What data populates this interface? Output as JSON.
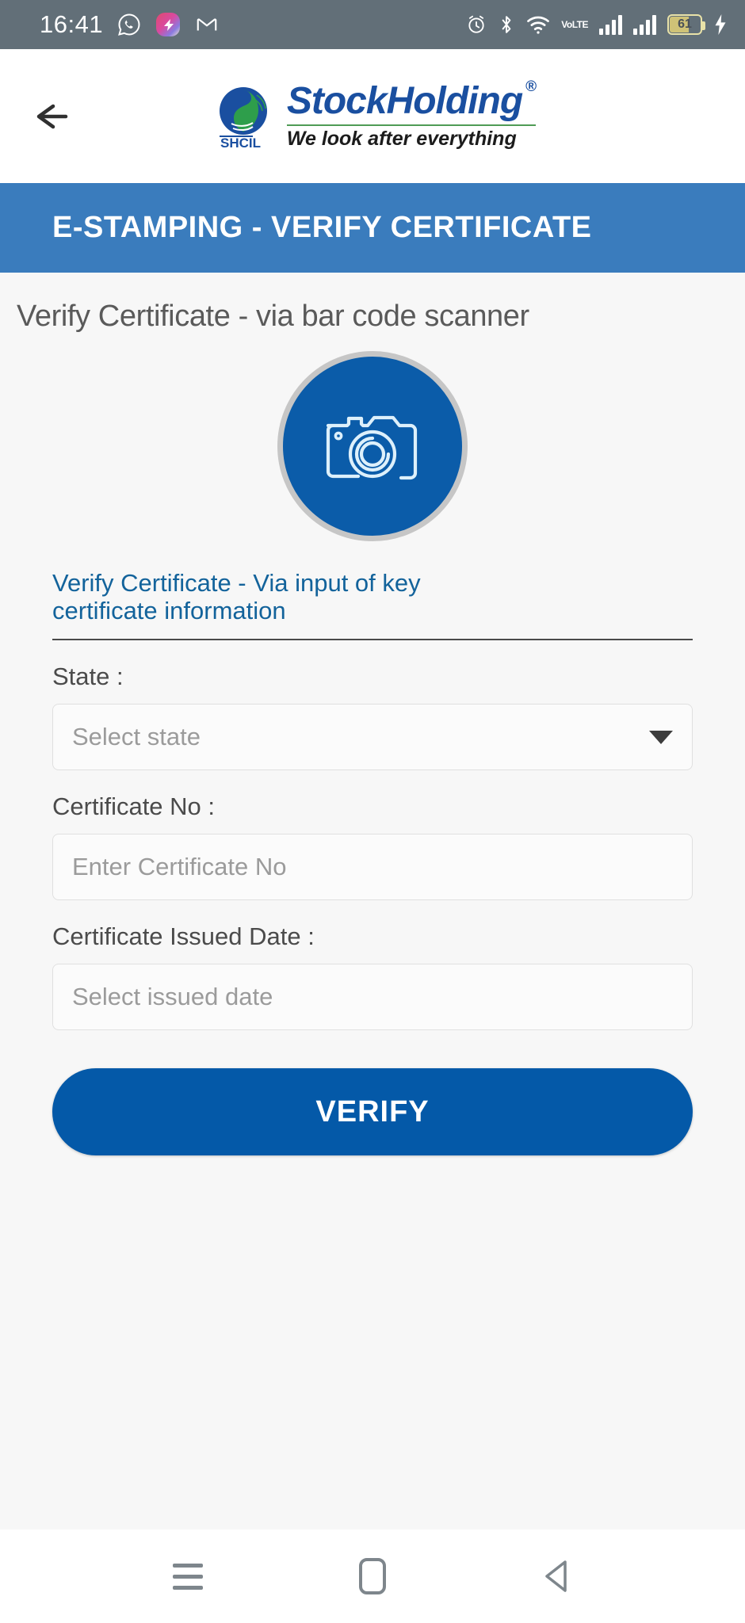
{
  "status_bar": {
    "time": "16:41",
    "left_icons": [
      "whatsapp-icon",
      "app-icon",
      "gmail-icon"
    ],
    "right_icons": [
      "alarm-icon",
      "bluetooth-icon",
      "wifi-icon",
      "volte-icon",
      "signal-sim1-icon",
      "signal-sim2-icon",
      "battery-icon"
    ],
    "volte_top": "Vo",
    "volte_bottom": "LTE",
    "battery_percent": "61",
    "charging": true
  },
  "header": {
    "back_icon": "back-arrow-icon",
    "logo_name": "StockHolding",
    "logo_registered": "®",
    "logo_tagline": "We look after everything",
    "logo_abbr": "SHCIL"
  },
  "banner": {
    "title": "E-STAMPING - VERIFY CERTIFICATE",
    "color": "#3a7cbd"
  },
  "main": {
    "scanner_heading": "Verify Certificate - via bar code scanner",
    "scanner_button_icon": "camera-icon",
    "scanner_button_color": "#0b5ca9",
    "key_info_link": "Verify Certificate - Via input of key certificate information",
    "key_info_link_color": "#13639b",
    "fields": [
      {
        "label": "State :",
        "placeholder": "Select state",
        "value": "",
        "type": "select",
        "icon": "chevron-down-icon"
      },
      {
        "label": "Certificate No :",
        "placeholder": "Enter Certificate No",
        "value": "",
        "type": "text"
      },
      {
        "label": "Certificate Issued Date :",
        "placeholder": "Select issued date",
        "value": "",
        "type": "date"
      }
    ],
    "verify_button": "VERIFY",
    "verify_button_color": "#0459a8"
  },
  "nav_bar": {
    "recents_icon": "recents-menu-icon",
    "home_icon": "home-icon",
    "back_icon": "back-triangle-icon"
  }
}
